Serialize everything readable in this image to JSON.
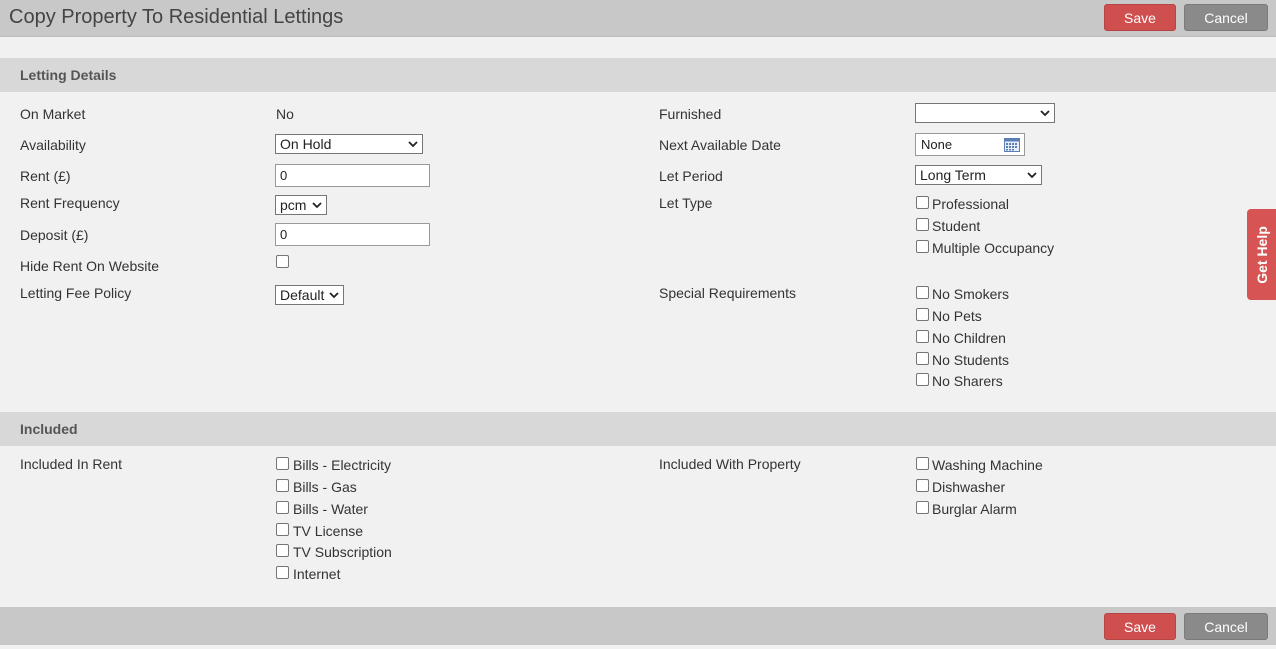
{
  "header": {
    "title": "Copy Property To Residential Lettings",
    "save_label": "Save",
    "cancel_label": "Cancel"
  },
  "letting_details": {
    "heading": "Letting Details",
    "on_market": {
      "label": "On Market",
      "value": "No"
    },
    "availability": {
      "label": "Availability",
      "value": "On Hold"
    },
    "rent": {
      "label": "Rent (£)",
      "value": "0"
    },
    "rent_frequency": {
      "label": "Rent Frequency",
      "value": "pcm"
    },
    "deposit": {
      "label": "Deposit (£)",
      "value": "0"
    },
    "hide_rent": {
      "label": "Hide Rent On Website",
      "checked": false
    },
    "letting_fee_policy": {
      "label": "Letting Fee Policy",
      "value": "Default"
    },
    "furnished": {
      "label": "Furnished",
      "value": ""
    },
    "next_available_date": {
      "label": "Next Available Date",
      "value": "None"
    },
    "let_period": {
      "label": "Let Period",
      "value": "Long Term"
    },
    "let_type": {
      "label": "Let Type",
      "options": [
        "Professional",
        "Student",
        "Multiple Occupancy"
      ]
    },
    "special_requirements": {
      "label": "Special Requirements",
      "options": [
        "No Smokers",
        "No Pets",
        "No Children",
        "No Students",
        "No Sharers"
      ]
    }
  },
  "included": {
    "heading": "Included",
    "in_rent": {
      "label": "Included In Rent",
      "options": [
        "Bills - Electricity",
        "Bills - Gas",
        "Bills - Water",
        "TV License",
        "TV Subscription",
        "Internet"
      ]
    },
    "with_property": {
      "label": "Included With Property",
      "options": [
        "Washing Machine",
        "Dishwasher",
        "Burglar Alarm"
      ]
    }
  },
  "help_tab": {
    "label": "Get Help"
  },
  "footer": {
    "save_label": "Save",
    "cancel_label": "Cancel"
  },
  "colors": {
    "save": "#cf4f4f",
    "cancel": "#8a8a8a",
    "help": "#d65454"
  },
  "icons": {
    "dropdown": "chevron-down-icon",
    "calendar": "calendar-icon"
  }
}
